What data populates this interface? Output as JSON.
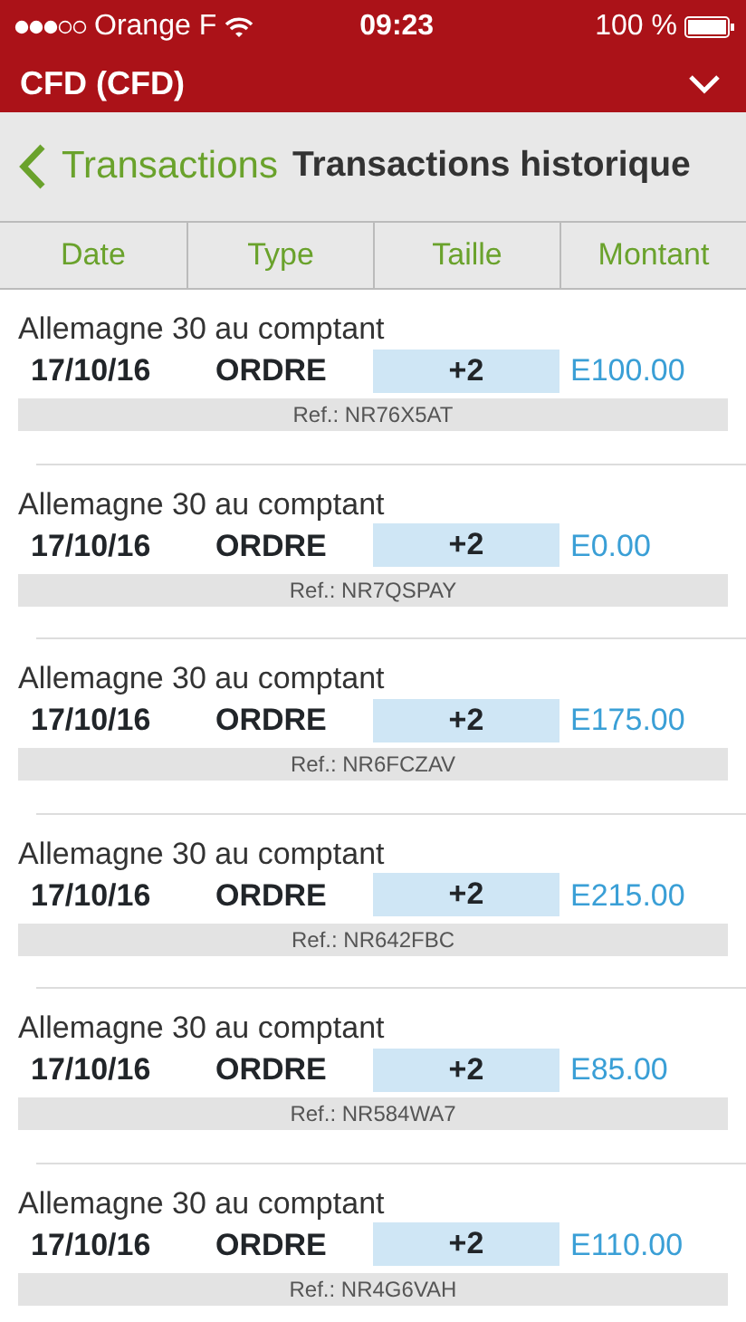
{
  "status_bar": {
    "carrier": "Orange F",
    "time": "09:23",
    "battery": "100 %"
  },
  "header": {
    "title": "CFD (CFD)"
  },
  "nav": {
    "back": "Transactions",
    "title": "Transactions historique"
  },
  "table": {
    "columns": [
      "Date",
      "Type",
      "Taille",
      "Montant"
    ],
    "rows": [
      {
        "name": "Allemagne 30 au comptant",
        "date": "17/10/16",
        "type": "ORDRE",
        "size": "+2",
        "amount": "E100.00",
        "ref": "Ref.: NR76X5AT"
      },
      {
        "name": "Allemagne 30 au comptant",
        "date": "17/10/16",
        "type": "ORDRE",
        "size": "+2",
        "amount": "E0.00",
        "ref": "Ref.: NR7QSPAY"
      },
      {
        "name": "Allemagne 30 au comptant",
        "date": "17/10/16",
        "type": "ORDRE",
        "size": "+2",
        "amount": "E175.00",
        "ref": "Ref.: NR6FCZAV"
      },
      {
        "name": "Allemagne 30 au comptant",
        "date": "17/10/16",
        "type": "ORDRE",
        "size": "+2",
        "amount": "E215.00",
        "ref": "Ref.: NR642FBC"
      },
      {
        "name": "Allemagne 30 au comptant",
        "date": "17/10/16",
        "type": "ORDRE",
        "size": "+2",
        "amount": "E85.00",
        "ref": "Ref.: NR584WA7"
      },
      {
        "name": "Allemagne 30 au comptant",
        "date": "17/10/16",
        "type": "ORDRE",
        "size": "+2",
        "amount": "E110.00",
        "ref": "Ref.: NR4G6VAH"
      }
    ]
  }
}
